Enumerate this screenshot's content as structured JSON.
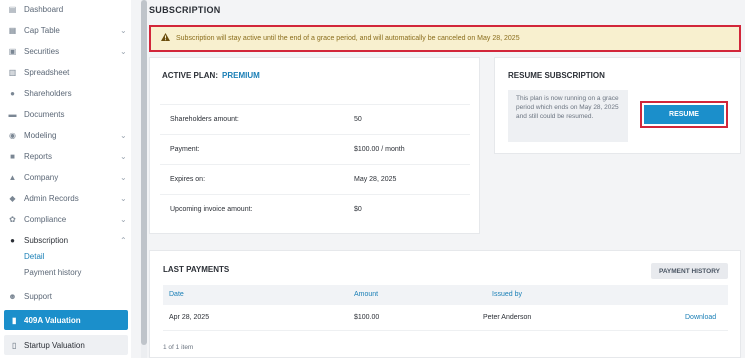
{
  "sidebar": {
    "items": [
      {
        "label": "Dashboard",
        "icon": "dashboard-icon"
      },
      {
        "label": "Cap Table",
        "icon": "cap-table-icon"
      },
      {
        "label": "Securities",
        "icon": "securities-icon"
      },
      {
        "label": "Spreadsheet",
        "icon": "spreadsheet-icon"
      },
      {
        "label": "Shareholders",
        "icon": "shareholders-icon"
      },
      {
        "label": "Documents",
        "icon": "documents-icon"
      },
      {
        "label": "Modeling",
        "icon": "modeling-icon"
      },
      {
        "label": "Reports",
        "icon": "reports-icon"
      },
      {
        "label": "Company",
        "icon": "company-icon"
      },
      {
        "label": "Admin Records",
        "icon": "admin-records-icon"
      },
      {
        "label": "Compliance",
        "icon": "compliance-icon"
      },
      {
        "label": "Subscription",
        "icon": "subscription-icon"
      }
    ],
    "subscription_sub": [
      "Detail",
      "Payment history"
    ],
    "support": "Support",
    "valuation_409a": "409A Valuation",
    "startup_valuation": "Startup Valuation"
  },
  "page": {
    "title": "SUBSCRIPTION",
    "alert": "Subscription will stay active until the end of a grace period, and will automatically be canceled on May 28, 2025"
  },
  "plan": {
    "label": "ACTIVE PLAN:",
    "name": "PREMIUM",
    "rows": [
      {
        "k": "Shareholders amount:",
        "v": "50"
      },
      {
        "k": "Payment:",
        "v": "$100.00 / month"
      },
      {
        "k": "Expires on:",
        "v": "May 28, 2025"
      },
      {
        "k": "Upcoming invoice amount:",
        "v": "$0"
      }
    ]
  },
  "resume": {
    "title": "RESUME SUBSCRIPTION",
    "note": "This plan is now running on a grace period which ends on May 28, 2025 and still could be resumed.",
    "button": "RESUME"
  },
  "payments": {
    "title": "LAST PAYMENTS",
    "history_button": "PAYMENT HISTORY",
    "columns": [
      "Date",
      "Amount",
      "Issued by"
    ],
    "rows": [
      {
        "date": "Apr 28, 2025",
        "amount": "$100.00",
        "issued_by": "Peter Anderson",
        "action": "Download"
      }
    ],
    "footer": "1 of 1 item"
  },
  "colors": {
    "accent": "#1b8fcb",
    "alert_bg": "#f8f0cf",
    "highlight_border": "#d2263a"
  }
}
